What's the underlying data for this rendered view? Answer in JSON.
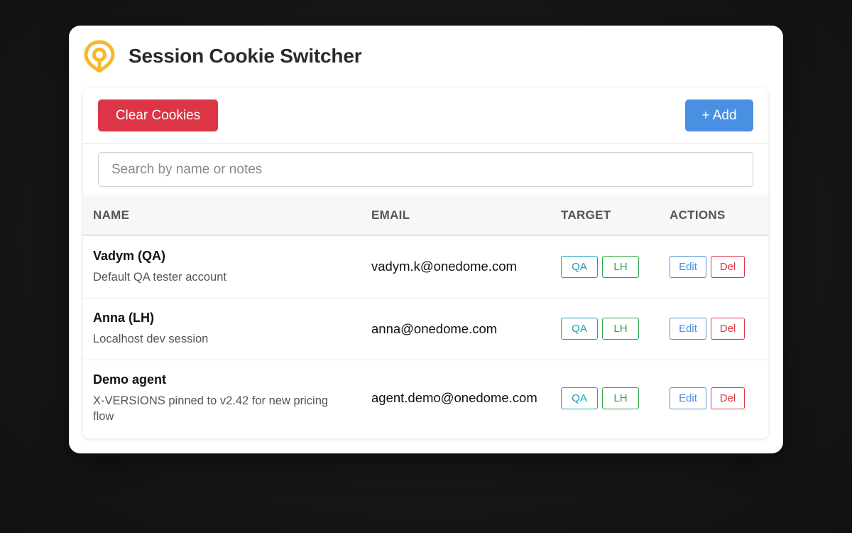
{
  "app": {
    "title": "Session Cookie Switcher",
    "logo_icon": "location-pin-icon",
    "brand_color": "#f5b82e"
  },
  "toolbar": {
    "clear_label": "Clear Cookies",
    "add_label": "+ Add",
    "clear_color": "#dc3545",
    "add_color": "#4a90e2"
  },
  "search": {
    "placeholder": "Search by name or notes",
    "value": ""
  },
  "table": {
    "headers": {
      "name": "NAME",
      "email": "EMAIL",
      "target": "TARGET",
      "actions": "ACTIONS"
    },
    "rows": [
      {
        "name": "Vadym (QA)",
        "note": "Default QA tester account",
        "email": "vadym.k@onedome.com",
        "targets": [
          "QA",
          "LH"
        ],
        "edit_label": "Edit",
        "del_label": "Del"
      },
      {
        "name": "Anna (LH)",
        "note": "Localhost dev session",
        "email": "anna@onedome.com",
        "targets": [
          "QA",
          "LH"
        ],
        "edit_label": "Edit",
        "del_label": "Del"
      },
      {
        "name": "Demo agent",
        "note": "X-VERSIONS pinned to v2.42 for new pricing flow",
        "email": "agent.demo@onedome.com",
        "targets": [
          "QA",
          "LH"
        ],
        "edit_label": "Edit",
        "del_label": "Del"
      }
    ]
  }
}
